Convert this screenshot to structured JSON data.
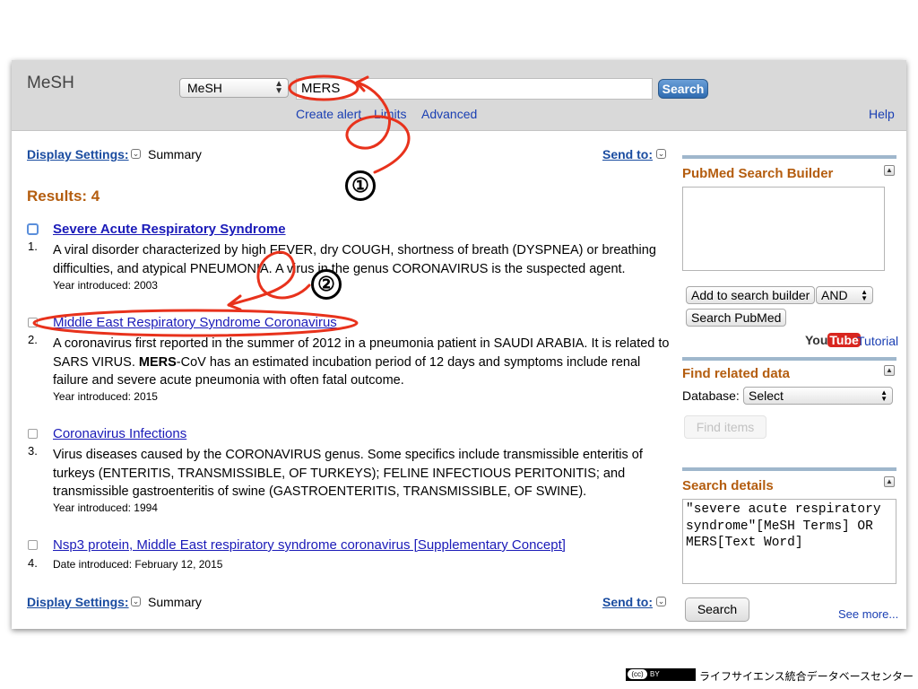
{
  "header": {
    "db_label": "MeSH",
    "db_select": "MeSH",
    "search_value": "MERS",
    "search_button": "Search",
    "links": {
      "create_alert": "Create alert",
      "limits": "Limits",
      "advanced": "Advanced",
      "help": "Help"
    }
  },
  "display_settings": {
    "label": "Display Settings:",
    "value": "Summary",
    "send_to": "Send to:"
  },
  "results_label": "Results: 4",
  "results": [
    {
      "num": "1.",
      "title": "Severe Acute Respiratory Syndrome",
      "desc": "A viral disorder characterized by high FEVER, dry COUGH, shortness of breath (DYSPNEA) or breathing difficulties, and atypical PNEUMONIA. A virus in the genus CORONAVIRUS is the suspected agent.",
      "year": "Year introduced: 2003"
    },
    {
      "num": "2.",
      "title": "Middle East Respiratory Syndrome Coronavirus",
      "desc_pre": "A coronavirus first reported in the summer of 2012 in a pneumonia patient in SAUDI ARABIA. It is related to SARS VIRUS. ",
      "desc_bold": "MERS",
      "desc_post": "-CoV has an estimated incubation period of 12 days and symptoms include renal failure and severe acute pneumonia with often fatal outcome.",
      "year": "Year introduced: 2015"
    },
    {
      "num": "3.",
      "title": "Coronavirus Infections",
      "desc": "Virus diseases caused by the CORONAVIRUS genus. Some specifics include transmissible enteritis of turkeys (ENTERITIS, TRANSMISSIBLE, OF TURKEYS); FELINE INFECTIOUS PERITONITIS; and transmissible gastroenteritis of swine (GASTROENTERITIS, TRANSMISSIBLE, OF SWINE).",
      "year": "Year introduced: 1994"
    },
    {
      "num": "4.",
      "title": "Nsp3 protein, Middle East respiratory syndrome coronavirus [Supplementary Concept]",
      "year": "Date introduced: February 12, 2015"
    }
  ],
  "sidebar": {
    "builder": {
      "title": "PubMed Search Builder",
      "add_button": "Add to search builder",
      "operator": "AND",
      "search_pubmed": "Search PubMed",
      "youtube_you": "You",
      "youtube_tube": "Tube",
      "tutorial": "Tutorial"
    },
    "related": {
      "title": "Find related data",
      "database_label": "Database:",
      "database_select": "Select",
      "find_items": "Find items"
    },
    "details": {
      "title": "Search details",
      "query": "\"severe acute respiratory syndrome\"[MeSH Terms] OR MERS[Text Word]",
      "search_button": "Search",
      "see_more": "See more..."
    }
  },
  "annotations": {
    "marker1": "①",
    "marker2": "②"
  },
  "footer": {
    "cc_badge": "(cc)",
    "cc_by": "BY",
    "credit": "ライフサイエンス統合データベースセンター"
  },
  "colors": {
    "accent_orange": "#b45d0f",
    "link_blue": "#1a1ab8",
    "annotation_red": "#e8321c"
  }
}
